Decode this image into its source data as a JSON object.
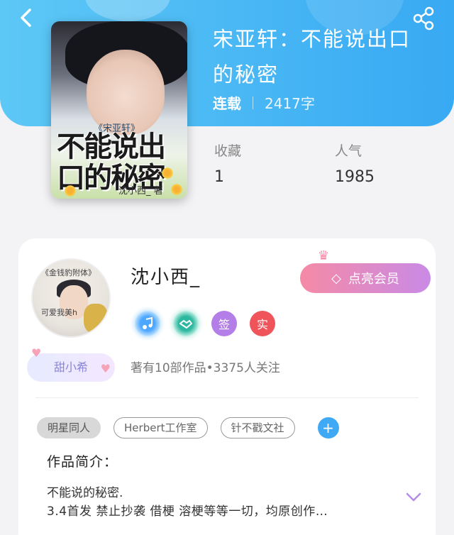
{
  "header": {
    "back_icon": "chevron-left-icon",
    "share_icon": "share-icon"
  },
  "book": {
    "title": "宋亚轩：不能说出口的秘密",
    "status": "连载",
    "word_count": "2417字",
    "cover": {
      "subtitle": "《宋亚轩》",
      "title_art": "不能说出口的秘密",
      "author_mark": "沈小西_ 著"
    },
    "stats": [
      {
        "label": "收藏",
        "value": "1"
      },
      {
        "label": "人气",
        "value": "1985"
      }
    ]
  },
  "author": {
    "name": "沈小西_",
    "avatar_text_top": "《金钱豹附体》",
    "avatar_text_bottom": "可爱我美h",
    "fan_badge": "甜小希",
    "vip_button": "点亮会员",
    "badges": [
      {
        "icon": "music-icon",
        "label": ""
      },
      {
        "icon": "handshake-icon",
        "label": ""
      },
      {
        "icon": "sign-icon",
        "label": "签"
      },
      {
        "icon": "verified-icon",
        "label": "实"
      }
    ],
    "stats_text": "著有10部作品•3375人关注"
  },
  "tags": [
    "明星同人",
    "Herbert工作室",
    "针不戳文社"
  ],
  "intro": {
    "title": "作品简介：",
    "line1": "不能说的秘密.",
    "line2": "3.4首发 禁止抄袭 借梗 溶梗等等一切，均原创作…"
  },
  "colors": {
    "header_start": "#5dc8f6",
    "header_end": "#38a9f3",
    "vip_start": "#f58aa6",
    "vip_end": "#c98ae6",
    "accent_blue": "#3fa9f5"
  }
}
